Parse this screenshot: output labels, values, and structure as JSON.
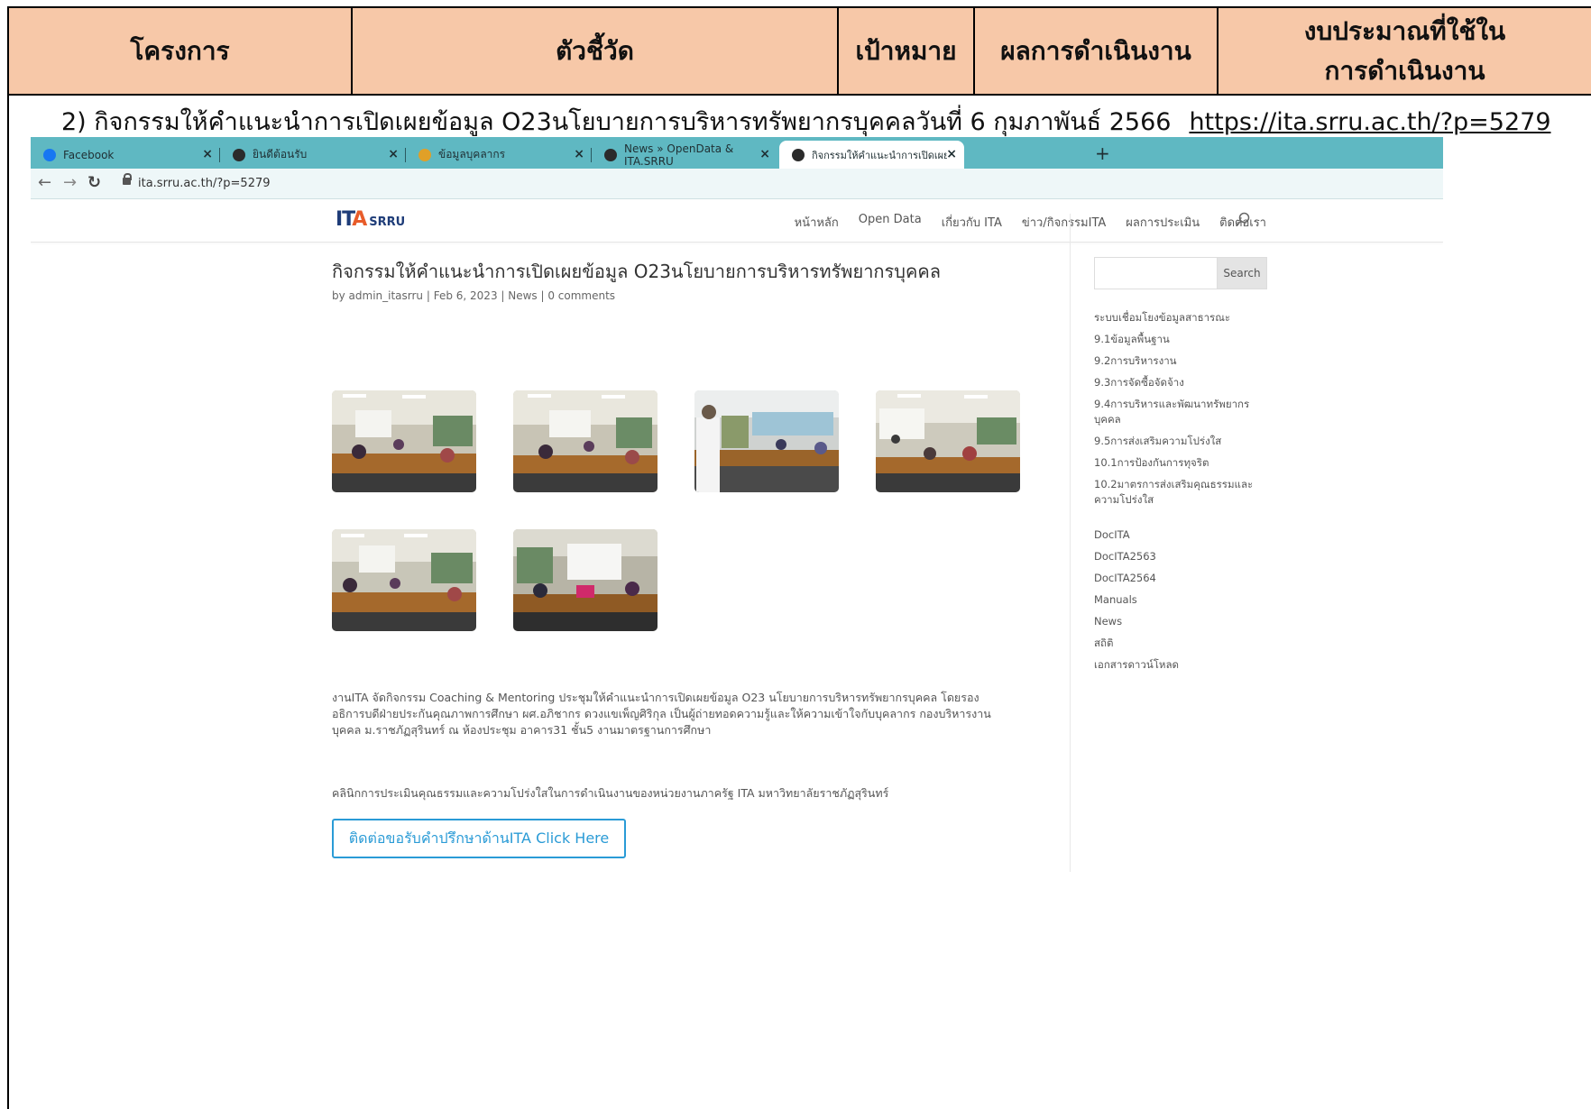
{
  "table_header": {
    "col1": "โครงการ",
    "col2": "ตัวชี้วัด",
    "col3": "เป้าหมาย",
    "col4": "ผลการดำเนินงาน",
    "col5_line1": "งบประมาณที่ใช้ใน",
    "col5_line2": "การดำเนินงาน"
  },
  "caption": {
    "text": "2) กิจกรรมให้คำแนะนำการเปิดเผยข้อมูล O23นโยบายการบริหารทรัพยากรบุคคลวันที่ 6 กุมภาพันธ์ 2566",
    "url": "https://ita.srru.ac.th/?p=5279"
  },
  "browser": {
    "tabs": [
      {
        "label": "Facebook",
        "icon_color": "#1877f2"
      },
      {
        "label": "ยินดีต้อนรับ",
        "icon_color": "#2b2b2b"
      },
      {
        "label": "ข้อมูลบุคลากร",
        "icon_color": "#e0a028"
      },
      {
        "label": "News » OpenData & ITA.SRRU",
        "icon_color": "#2b2b2b"
      },
      {
        "label": "กิจกรรมให้คำแนะนำการเปิดเผยข้อมูล (",
        "icon_color": "#2b2b2b"
      }
    ],
    "new_tab": "+",
    "address": "ita.srru.ac.th/?p=5279"
  },
  "site": {
    "logo_main": "IT",
    "logo_accent": "A",
    "logo_sub": "SRRU",
    "menu": [
      "หน้าหลัก",
      "Open Data",
      "เกี่ยวกับ ITA",
      "ข่าว/กิจกรรมITA",
      "ผลการประเมิน",
      "ติดต่อเรา"
    ]
  },
  "post": {
    "title": "กิจกรรมให้คำแนะนำการเปิดเผยข้อมูล O23นโยบายการบริหารทรัพยากรบุคคล",
    "meta": "by admin_itasrru | Feb 6, 2023 | News | 0 comments",
    "body_line1": "งานITA จัดกิจกรรม Coaching & Mentoring ประชุมให้คำแนะนำการเปิดเผยข้อมูล O23 นโยบายการบริหารทรัพยากรบุคคล โดยรอง",
    "body_line2": "อธิการบดีฝ่ายประกันคุณภาพการศึกษา ผศ.อภิชากร ดวงแขเพ็ญศิริกุล เป็นผู้ถ่ายทอดความรู้และให้ความเข้าใจกับบุคลากร กองบริหารงาน",
    "body_line3": "บุคคล ม.ราชภัฏสุรินทร์ ณ ห้องประชุม อาคาร31 ชั้น5 งานมาตรฐานการศึกษา",
    "note": "คลินิกการประเมินคุณธรรมและความโปร่งใสในการดำเนินงานของหน่วยงานภาครัฐ ITA มหาวิทยาลัยราชภัฏสุรินทร์",
    "cta": "ติดต่อขอรับคำปรึกษาด้านITA Click Here"
  },
  "sidebar": {
    "search_button": "Search",
    "items": [
      "ระบบเชื่อมโยงข้อมูลสาธารณะ",
      "9.1ข้อมูลพื้นฐาน",
      "9.2การบริหารงาน",
      "9.3การจัดซื้อจัดจ้าง",
      "9.4การบริหารและพัฒนาทรัพยากร บุคคล",
      "9.5การส่งเสริมความโปร่งใส",
      "10.1การป้องกันการทุจริต",
      "10.2มาตรการส่งเสริมคุณธรรมและ ความโปร่งใส"
    ],
    "categories": [
      "DocITA",
      "DocITA2563",
      "DocITA2564",
      "Manuals",
      "News",
      "สถิติ",
      "เอกสารดาวน์โหลด"
    ]
  }
}
